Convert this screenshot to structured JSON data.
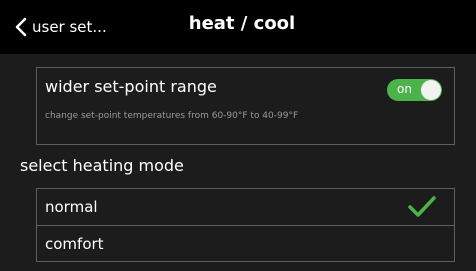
{
  "header": {
    "back_label": "user set...",
    "title": "heat / cool"
  },
  "setting": {
    "title": "wider set-point range",
    "description": "change set-point temperatures from 60-90°F to 40-99°F",
    "toggle_label": "on",
    "toggle_state": "on",
    "toggle_color": "#4cb34a"
  },
  "heating_mode": {
    "title": "select heating mode",
    "options": [
      {
        "label": "normal",
        "selected": true
      },
      {
        "label": "comfort",
        "selected": false
      }
    ],
    "check_color": "#4cb34a"
  },
  "icons": {
    "back": "chevron-left-icon",
    "selected": "checkmark-icon"
  }
}
